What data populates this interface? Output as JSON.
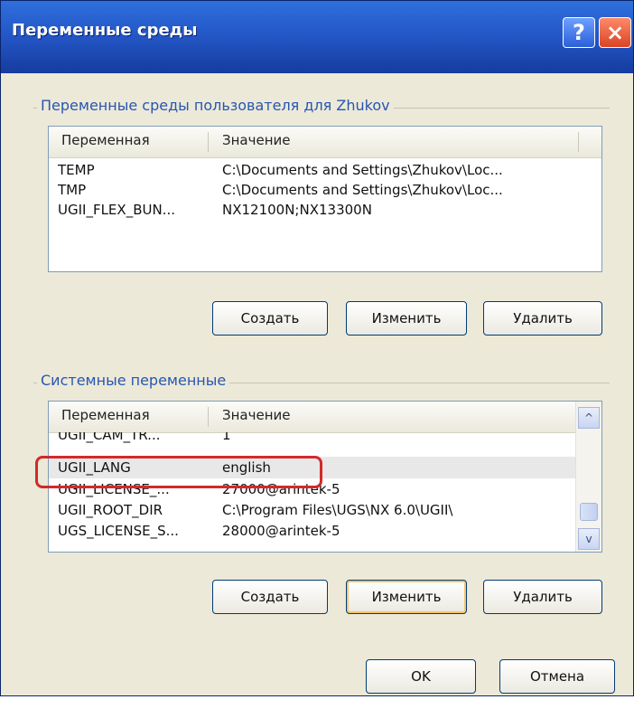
{
  "window": {
    "title": "Переменные среды",
    "help_glyph": "?",
    "close_glyph": "×"
  },
  "user_vars": {
    "group_title": "Переменные среды пользователя для Zhukov",
    "columns": [
      "Переменная",
      "Значение"
    ],
    "rows": [
      {
        "var": "TEMP",
        "val": "C:\\Documents and Settings\\Zhukov\\Loc..."
      },
      {
        "var": "TMP",
        "val": "C:\\Documents and Settings\\Zhukov\\Loc..."
      },
      {
        "var": "UGII_FLEX_BUN...",
        "val": "NX12100N;NX13300N"
      }
    ],
    "buttons": {
      "create": "Создать",
      "edit": "Изменить",
      "delete": "Удалить"
    }
  },
  "system_vars": {
    "group_title": "Системные переменные",
    "columns": [
      "Переменная",
      "Значение"
    ],
    "rows": [
      {
        "var": "UGII_CAM_TR...",
        "val": "1"
      },
      {
        "var": "UGII_LANG",
        "val": "english"
      },
      {
        "var": "UGII_LICENSE_...",
        "val": "27000@arintek-5"
      },
      {
        "var": "UGII_ROOT_DIR",
        "val": "C:\\Program Files\\UGS\\NX 6.0\\UGII\\"
      },
      {
        "var": "UGS_LICENSE_S...",
        "val": "28000@arintek-5"
      }
    ],
    "selected_index": 1,
    "scroll_up": "^",
    "scroll_down": "v",
    "buttons": {
      "create": "Создать",
      "edit": "Изменить",
      "delete": "Удалить"
    }
  },
  "dialog_buttons": {
    "ok": "OK",
    "cancel": "Отмена"
  }
}
